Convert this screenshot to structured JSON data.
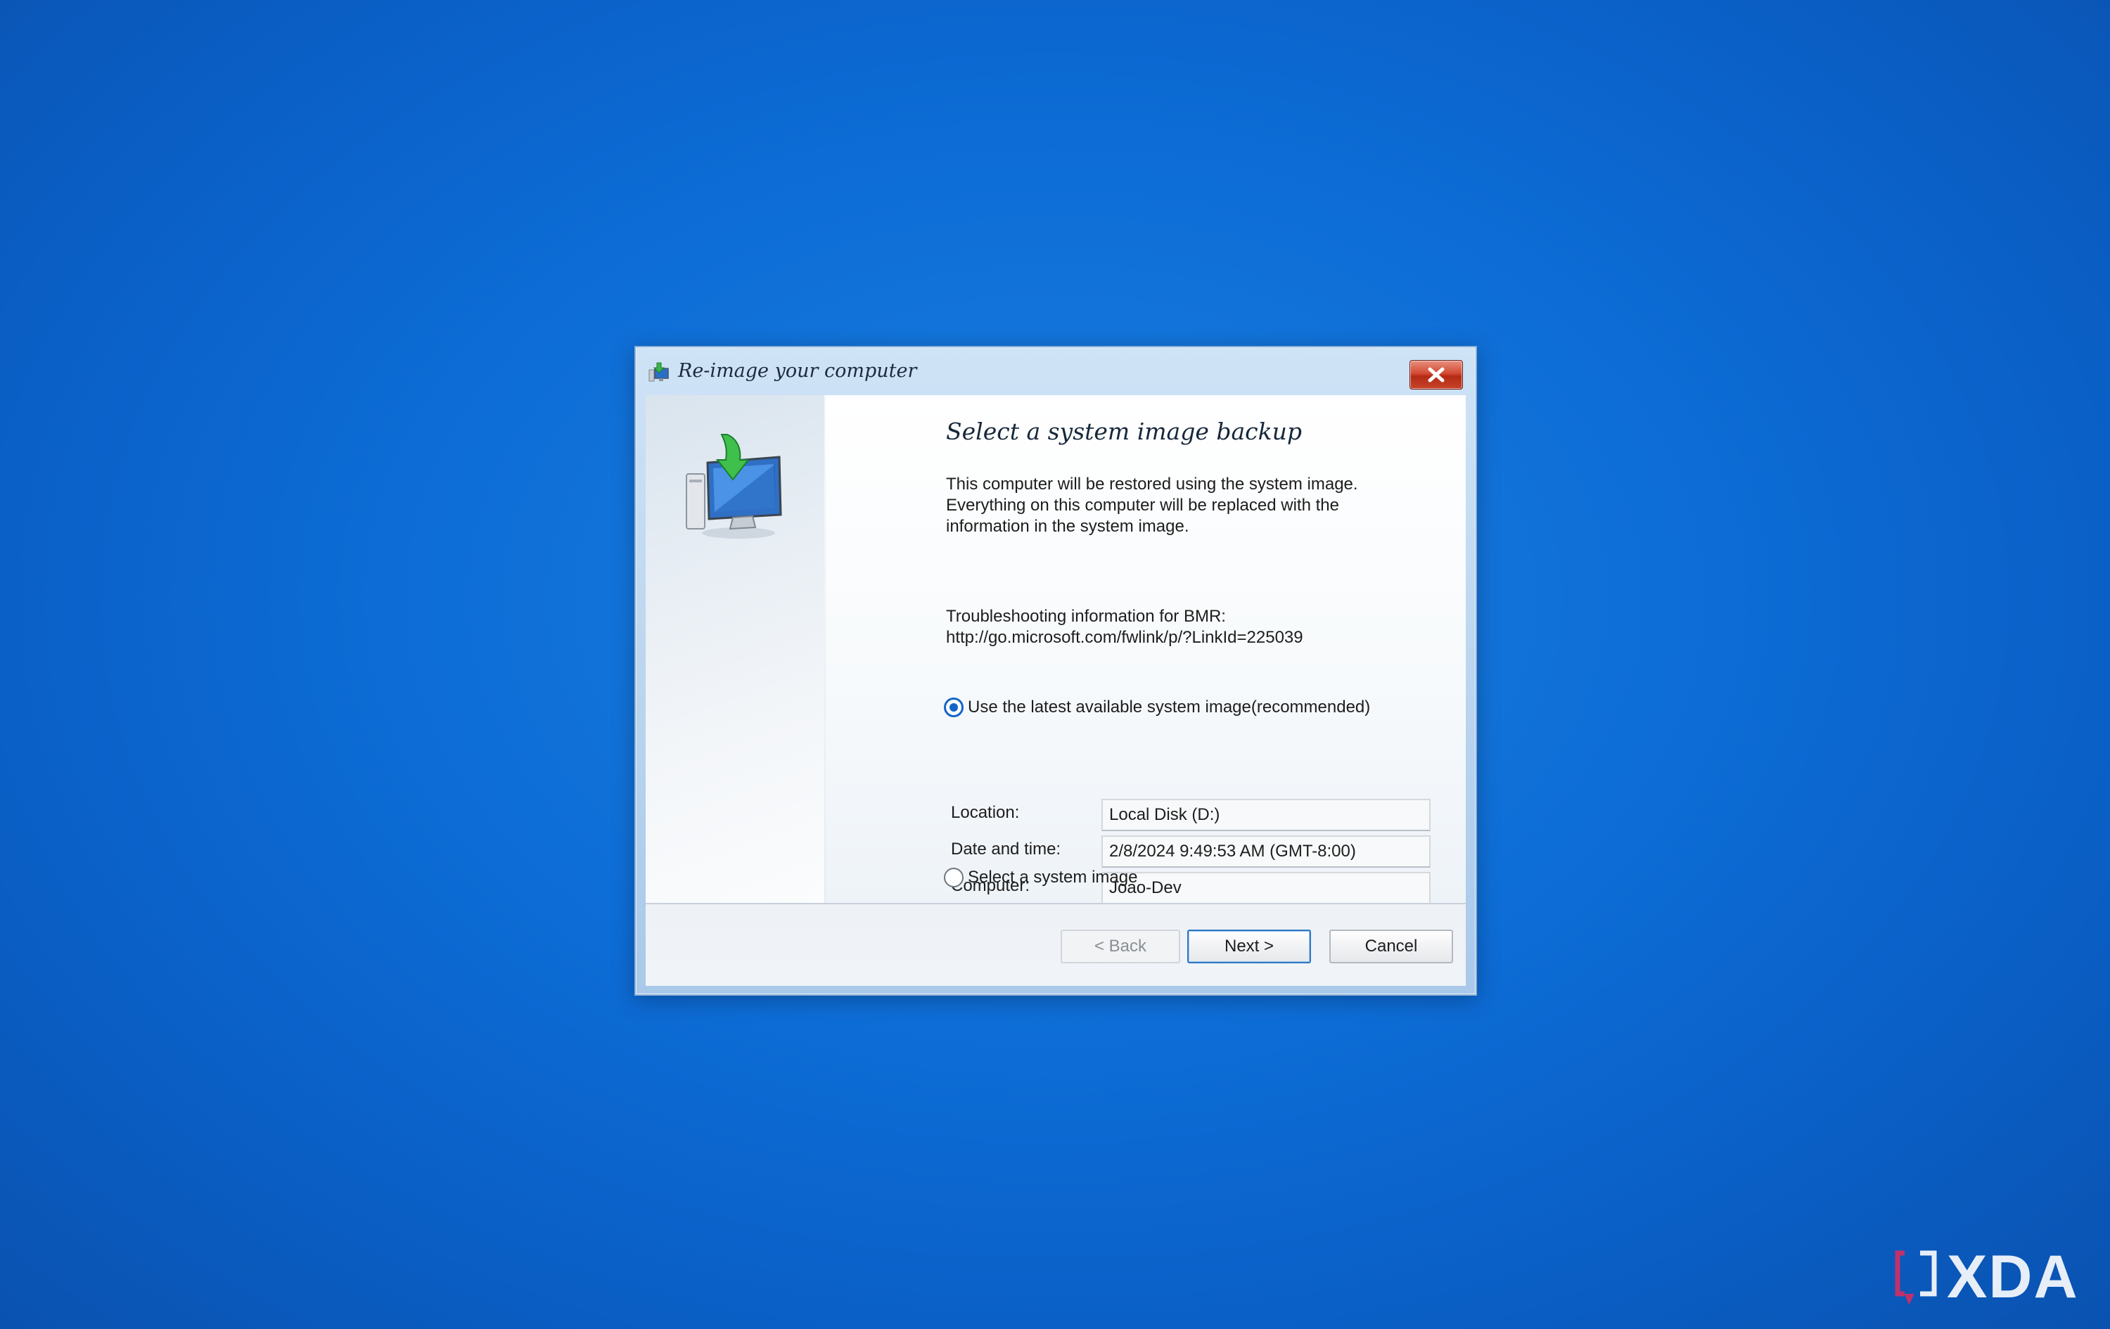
{
  "window": {
    "title": "Re-image your computer",
    "close_icon": "close-icon"
  },
  "wizard": {
    "heading": "Select a system image backup",
    "description_lines": [
      "This computer will be restored using the system image.",
      "Everything on this computer will be replaced with the",
      "information in the system image."
    ],
    "troubleshooting_lines": [
      "Troubleshooting information for BMR:",
      "http://go.microsoft.com/fwlink/p/?LinkId=225039"
    ],
    "options": [
      {
        "label": "Use the latest available system image(recommended)",
        "selected": true
      },
      {
        "label": "Select a system image",
        "selected": false
      }
    ],
    "details": {
      "location_label": "Location:",
      "location_value": "Local Disk (D:)",
      "date_label": "Date and time:",
      "date_value": "2/8/2024 9:49:53 AM (GMT-8:00)",
      "computer_label": "Computer:",
      "computer_value": "Joao-Dev"
    }
  },
  "buttons": {
    "back": "< Back",
    "next": "Next >",
    "cancel": "Cancel"
  },
  "watermark": {
    "text": "XDA"
  },
  "colors": {
    "desktop_background": "#0d6cd6",
    "accent": "#1565c8",
    "close_button": "#c7432a"
  }
}
